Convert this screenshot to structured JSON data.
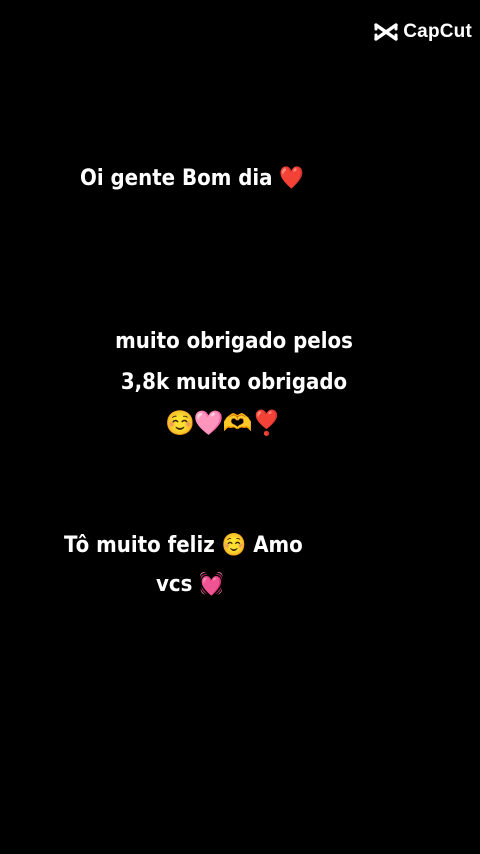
{
  "watermark": {
    "brand": "CapCut",
    "icon": "capcut-logo-icon"
  },
  "captions": {
    "line1_text": "Oi gente Bom dia ",
    "line1_emoji": "❤️",
    "line2": "muito obrigado pelos",
    "line3": "3,8k muito obrigado",
    "line4_emojis": "☺️🩷🫶❣️",
    "line5_text": "Tô muito feliz ",
    "line5_emoji": "☺️",
    "line5_tail": " Amo",
    "line6_text": "vcs ",
    "line6_emoji": "💓"
  },
  "colors": {
    "background": "#000000",
    "text": "#ffffff"
  }
}
